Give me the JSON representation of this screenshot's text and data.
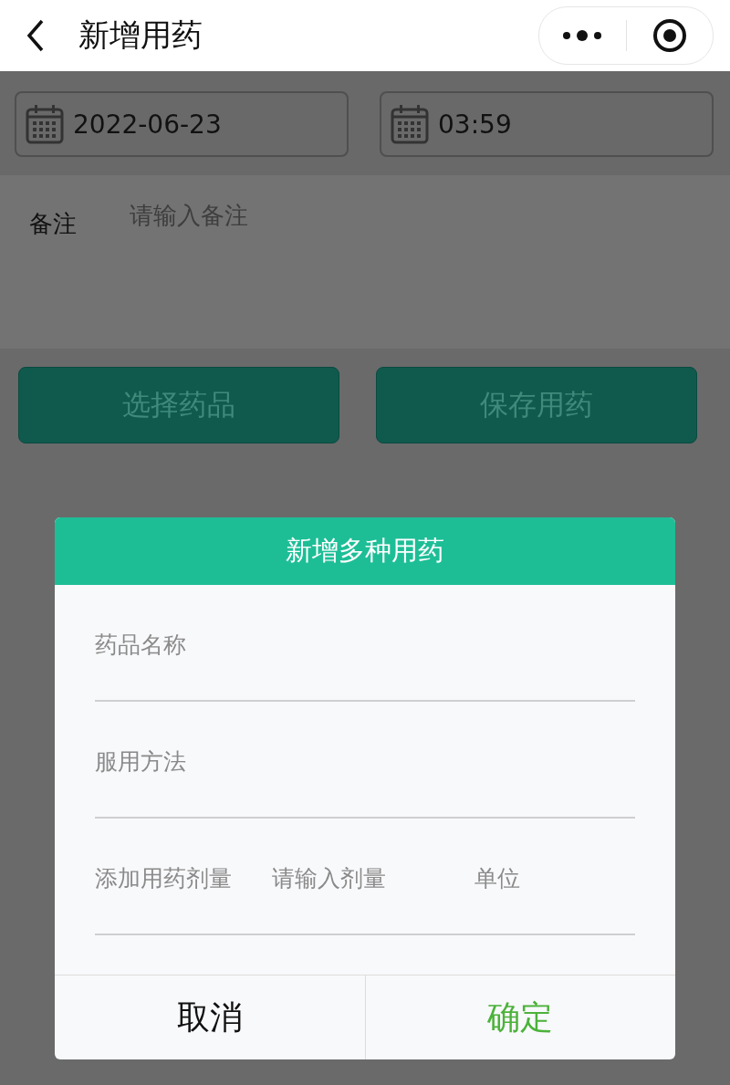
{
  "nav_bar": {
    "title": "新增用药"
  },
  "date_field": {
    "value": "2022-06-23"
  },
  "time_field": {
    "value": "03:59"
  },
  "note": {
    "label": "备注",
    "placeholder": "请输入备注"
  },
  "buttons": [
    {
      "label": "选择药品"
    },
    {
      "label": "保存用药"
    }
  ],
  "dialog": {
    "title": "新增多种用药",
    "fields": [
      {
        "kind": "text",
        "placeholder": "药品名称"
      },
      {
        "kind": "text",
        "placeholder": "服用方法"
      },
      {
        "kind": "dose",
        "label": "添加用药剂量",
        "placeholder": "请输入剂量",
        "unit_placeholder": "单位"
      }
    ],
    "cancel": "取消",
    "confirm": "确定"
  }
}
